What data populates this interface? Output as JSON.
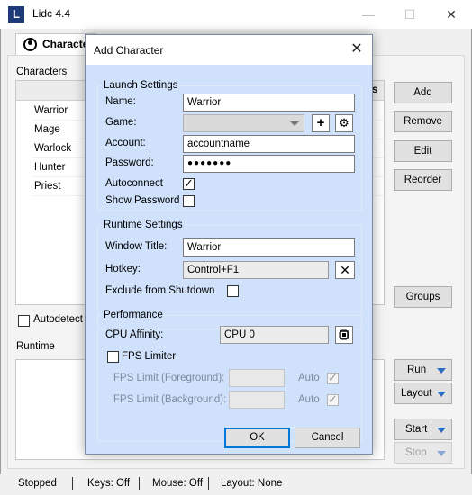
{
  "app": {
    "title": "Lidc 4.4",
    "tab_label": "Characters"
  },
  "window_controls": {
    "minimize": "—",
    "maximize": "☐",
    "close": "✕"
  },
  "characters_panel": {
    "group_label": "Characters",
    "column_header_partial": "s",
    "rows": [
      "Warrior",
      "Mage",
      "Warlock",
      "Hunter",
      "Priest"
    ],
    "buttons": {
      "add": "Add",
      "remove": "Remove",
      "edit": "Edit",
      "reorder": "Reorder",
      "groups": "Groups"
    },
    "autodetect_label": "Autodetect F"
  },
  "runtime_panel": {
    "group_label": "Runtime",
    "buttons": {
      "run": "Run",
      "layout": "Layout",
      "start": "Start",
      "stop": "Stop"
    }
  },
  "status_bar": {
    "state": "Stopped",
    "keys": "Keys: Off",
    "mouse": "Mouse: Off",
    "layout": "Layout: None"
  },
  "dialog": {
    "title": "Add Character",
    "close_glyph": "✕",
    "launch_settings": {
      "legend": "Launch Settings",
      "name_label": "Name:",
      "name_value": "Warrior",
      "game_label": "Game:",
      "game_value": "",
      "add_game_glyph": "+",
      "settings_glyph": "⚙",
      "account_label": "Account:",
      "account_value": "accountname",
      "password_label": "Password:",
      "password_value": "●●●●●●●",
      "autoconnect_label": "Autoconnect",
      "autoconnect_checked": true,
      "show_password_label": "Show Password",
      "show_password_checked": false
    },
    "runtime_settings": {
      "legend": "Runtime Settings",
      "window_title_label": "Window Title:",
      "window_title_value": "Warrior",
      "hotkey_label": "Hotkey:",
      "hotkey_value": "Control+F1",
      "clear_hotkey_glyph": "✕",
      "exclude_label": "Exclude from Shutdown",
      "exclude_checked": false
    },
    "performance": {
      "legend": "Performance",
      "cpu_affinity_label": "CPU Affinity:",
      "cpu_affinity_value": "CPU 0",
      "fps_limiter_label": "FPS Limiter",
      "fps_limiter_checked": false,
      "fps_fg_label": "FPS Limit (Foreground):",
      "fps_fg_value": "",
      "fps_fg_auto_label": "Auto",
      "fps_bg_label": "FPS Limit (Background):",
      "fps_bg_value": "",
      "fps_bg_auto_label": "Auto"
    },
    "buttons": {
      "ok": "OK",
      "cancel": "Cancel"
    }
  },
  "colors": {
    "dialog_bg": "#cfe1fb",
    "accent": "#0078d7",
    "logo_bg": "#1e3a78"
  }
}
